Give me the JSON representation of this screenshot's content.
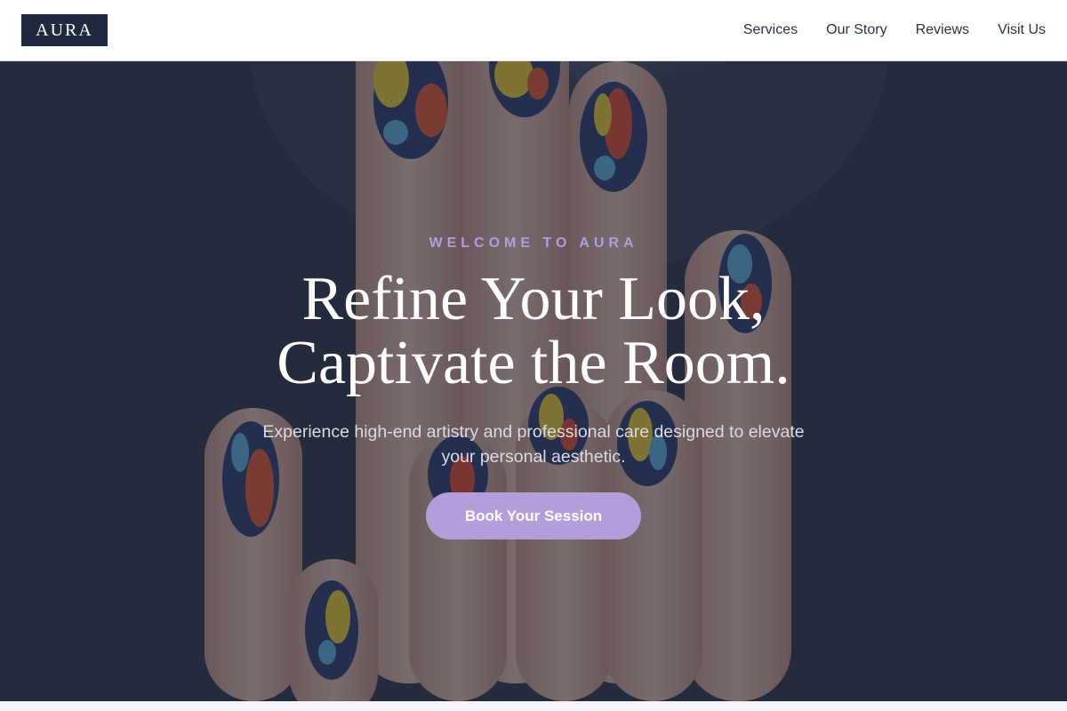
{
  "brand": {
    "logo_text": "AURA",
    "logo_bg_color": "#1f2a40",
    "logo_text_color": "#ffffff",
    "accent_color": "#b39ddb"
  },
  "nav": {
    "links": [
      {
        "label": "Services"
      },
      {
        "label": "Our Story"
      },
      {
        "label": "Reviews"
      },
      {
        "label": "Visit Us"
      }
    ]
  },
  "hero": {
    "eyebrow": "WELCOME TO AURA",
    "title_line1": "Refine Your Look,",
    "title_line2": "Captivate the Room.",
    "subtitle_line1": "Experience high-end artistry and professional care designed to elevate",
    "subtitle_line2": "your personal aesthetic.",
    "cta_label": "Book Your Session",
    "background_image": "hand-with-colorful-painted-nails-photo"
  }
}
